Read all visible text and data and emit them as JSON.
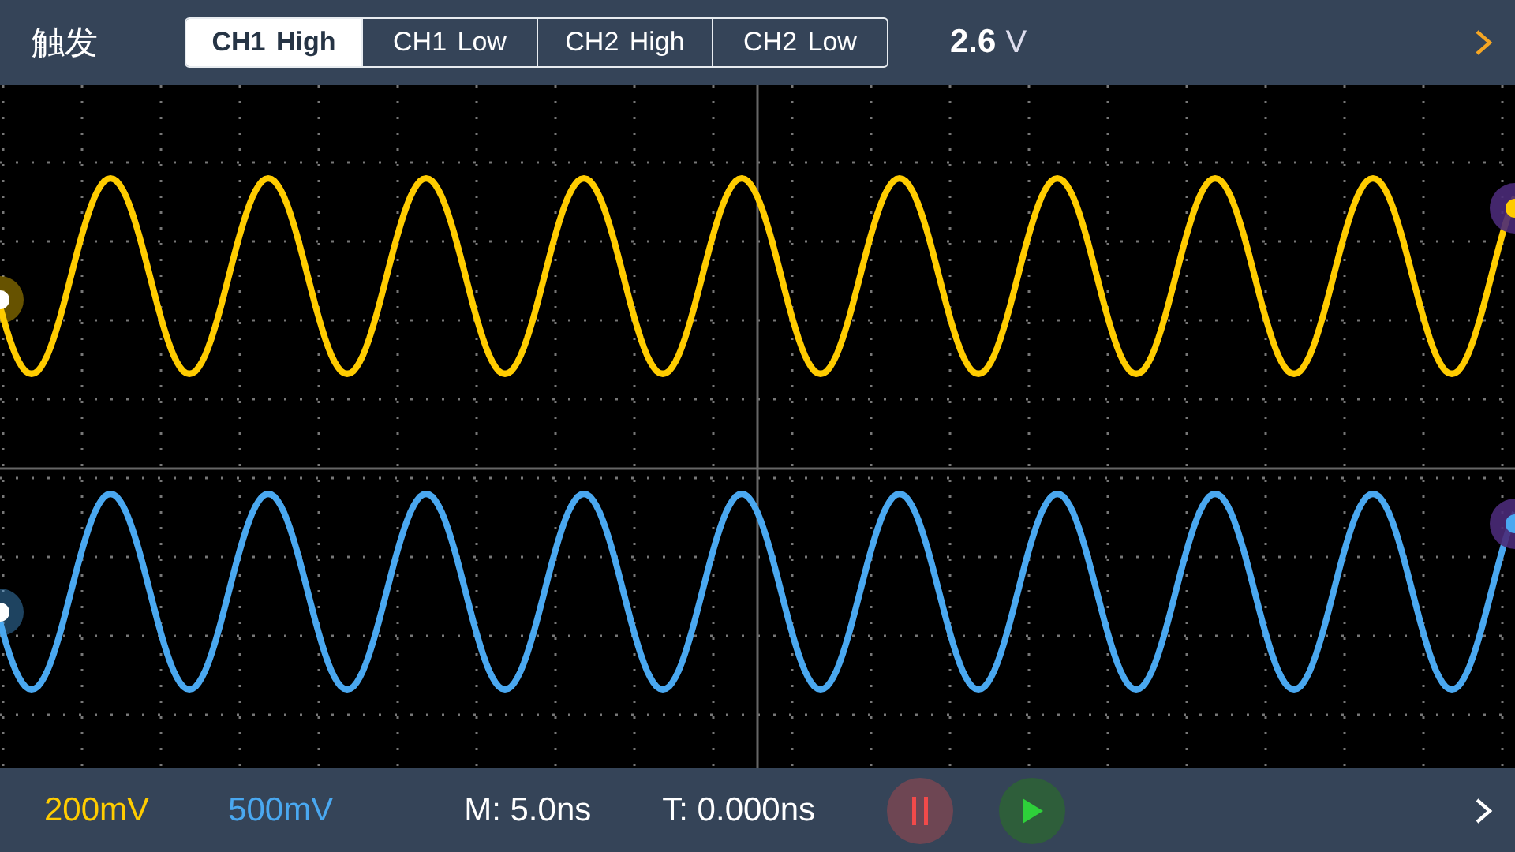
{
  "top_bar": {
    "title": "触发",
    "tabs": [
      {
        "label": "CH1 High",
        "selected": true
      },
      {
        "label": "CH1 Low",
        "selected": false
      },
      {
        "label": "CH2 High",
        "selected": false
      },
      {
        "label": "CH2 Low",
        "selected": false
      }
    ],
    "level": {
      "value": "2.6",
      "unit": "V"
    }
  },
  "channels": [
    {
      "color": "#ffcc00"
    },
    {
      "color": "#4aa8f0"
    }
  ],
  "bottom_bar": {
    "scales": [
      {
        "text": "200mV",
        "color": "#ffcc00"
      },
      {
        "text": "500mV",
        "color": "#4aa8f0"
      }
    ],
    "timebase": "M: 5.0ns",
    "trigger_time": "T: 0.000ns"
  }
}
